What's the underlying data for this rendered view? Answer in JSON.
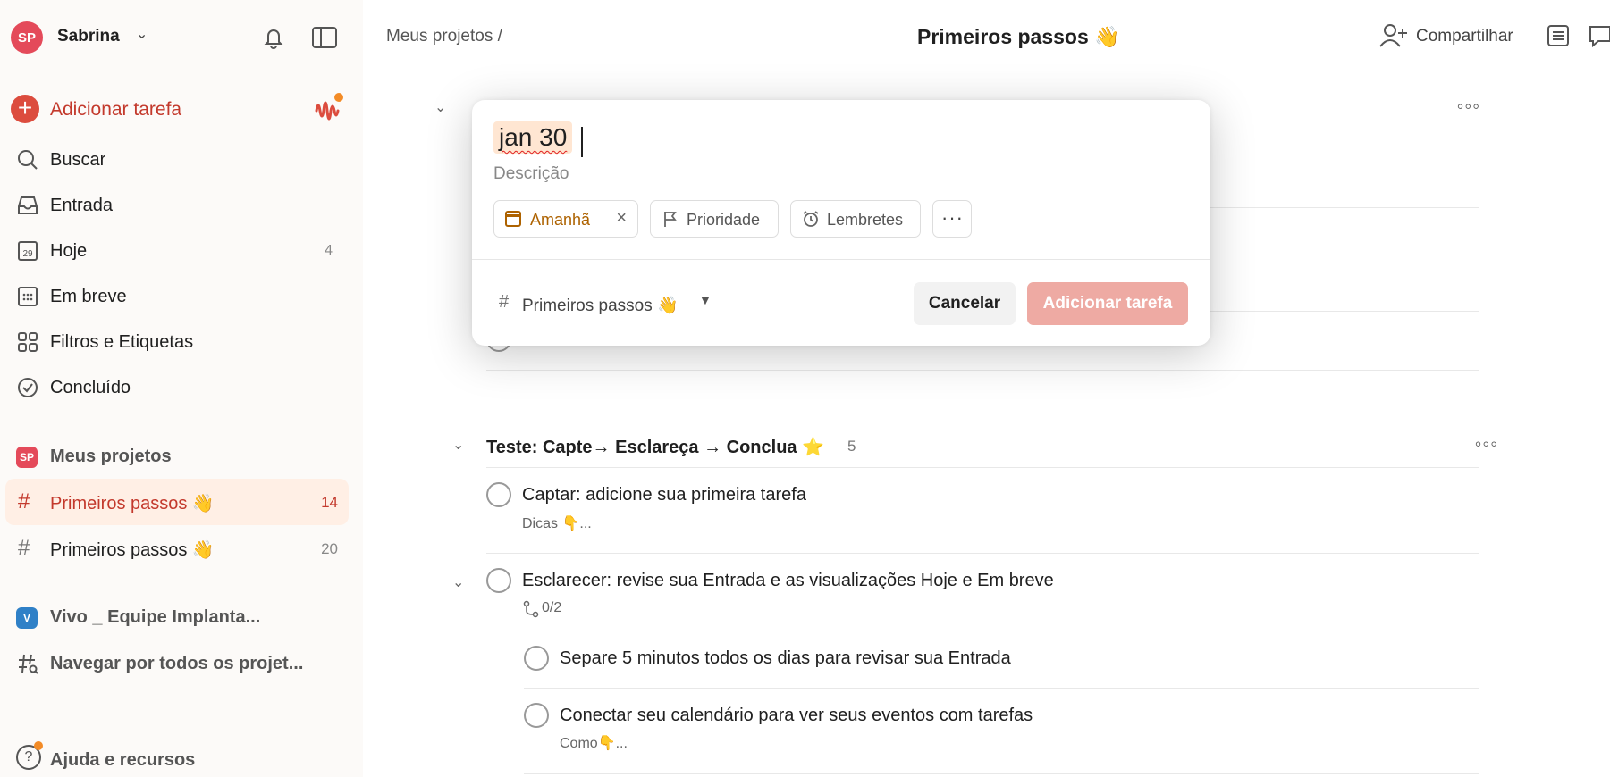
{
  "sidebar": {
    "user": {
      "initials": "SP",
      "name": "Sabrina"
    },
    "add_task_label": "Adicionar tarefa",
    "nav": [
      {
        "label": "Buscar",
        "count": ""
      },
      {
        "label": "Entrada",
        "count": ""
      },
      {
        "label": "Hoje",
        "count": "4"
      },
      {
        "label": "Em breve",
        "count": ""
      },
      {
        "label": "Filtros e Etiquetas",
        "count": ""
      },
      {
        "label": "Concluído",
        "count": ""
      }
    ],
    "my_projects": {
      "badge": "SP",
      "label": "Meus projetos",
      "badge_color": "#e44a5a"
    },
    "projects": [
      {
        "label": "Primeiros passos 👋",
        "count": "14"
      },
      {
        "label": "Primeiros passos 👋",
        "count": "20"
      }
    ],
    "team": {
      "badge": "V",
      "label": "Vivo _ Equipe Implanta...",
      "badge_color": "#2f80c7"
    },
    "browse_label": "Navegar por todos os projet...",
    "help_label": "Ajuda e recursos"
  },
  "header": {
    "breadcrumb": "Meus projetos /",
    "title": "Primeiros passos 👋",
    "share_label": "Compartilhar"
  },
  "sections": [
    {
      "title": "Teste: Capte→ Esclareça → Conclua ⭐",
      "count": "5",
      "tasks": [
        {
          "title": "Captar: adicione sua primeira tarefa",
          "sub": "Dicas 👇..."
        },
        {
          "title": "Esclarecer: revise sua Entrada e as visualizações Hoje e Em breve",
          "sub": "0/2"
        },
        {
          "title": "Separe 5 minutos todos os dias para revisar sua Entrada",
          "sub": ""
        },
        {
          "title": "Conectar seu calendário para ver seus eventos com tarefas",
          "sub": "Como👇..."
        }
      ]
    }
  ],
  "quick_add": {
    "input_value": "jan 30",
    "description_placeholder": "Descrição",
    "date_chip": "Amanhã",
    "priority_chip": "Prioridade",
    "reminders_chip": "Lembretes",
    "more_chip": "···",
    "project": "Primeiros passos 👋",
    "cancel_label": "Cancelar",
    "submit_label": "Adicionar tarefa"
  },
  "colors": {
    "accent": "#dc4c3e",
    "active_bg": "#ffefe5",
    "date_accent": "#ad6200"
  }
}
